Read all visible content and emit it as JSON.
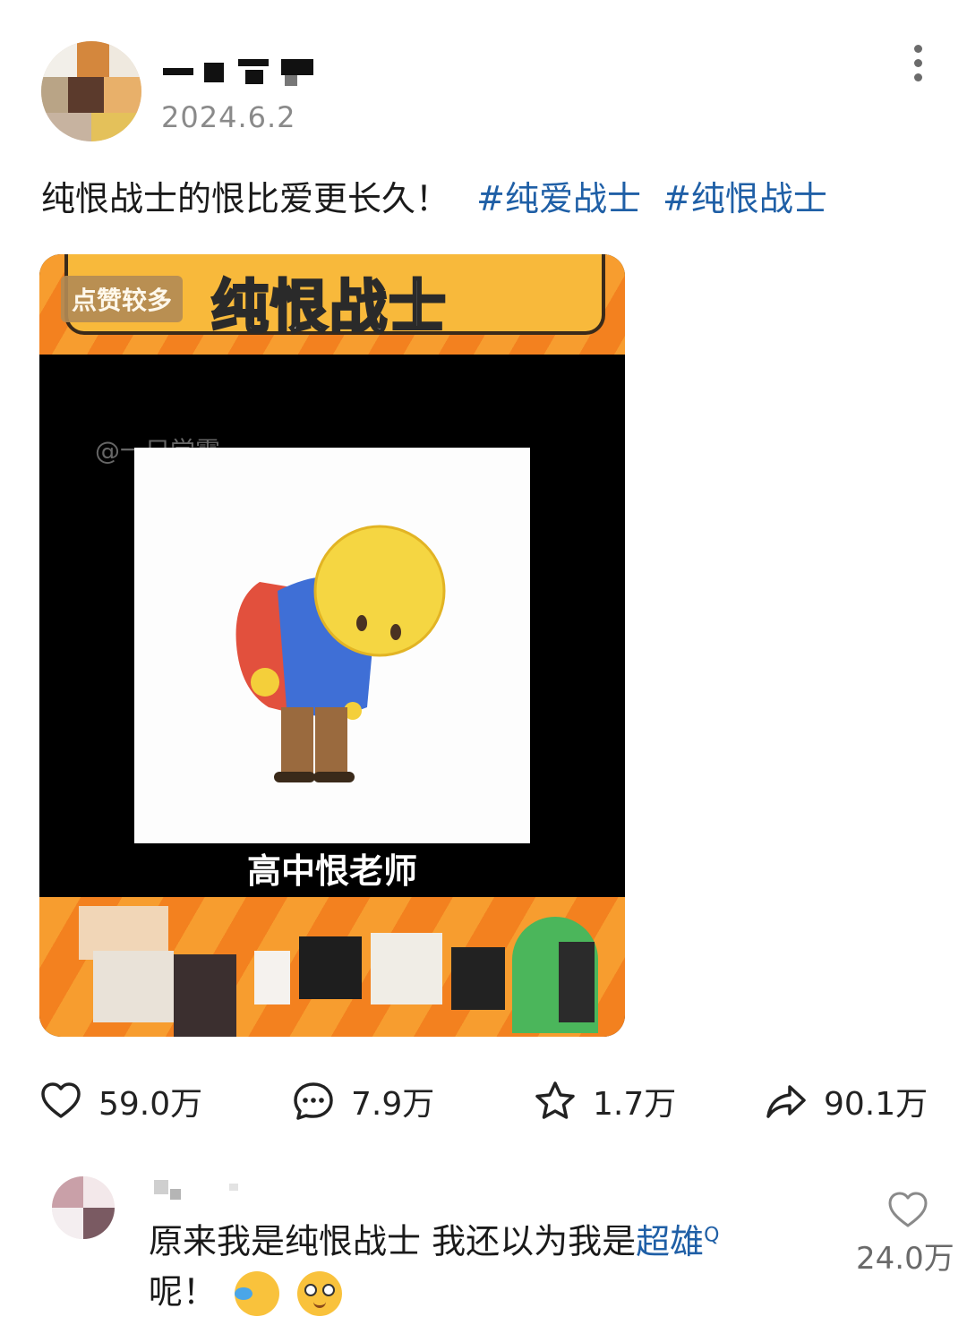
{
  "post": {
    "date": "2024.6.2",
    "text": "纯恨战士的恨比爱更长久！",
    "hashtags": [
      "#纯爱战士",
      "#纯恨战士"
    ]
  },
  "media": {
    "badge": "点赞较多",
    "title": "纯恨战士",
    "watermark": "@一只学霸",
    "caption": "高中恨老师"
  },
  "stats": {
    "likes": "59.0万",
    "comments": "7.9万",
    "favorites": "1.7万",
    "shares": "90.1万"
  },
  "comment": {
    "text_before": "原来我是纯恨战士 我还以为我是",
    "link": "超雄",
    "link_icon": "Q",
    "text_after": "呢！",
    "likes": "24.0万"
  },
  "icons": {
    "more": "more-vertical-icon",
    "like": "heart-icon",
    "comment": "comment-bubble-icon",
    "favorite": "star-icon",
    "share": "share-arrow-icon"
  },
  "colors": {
    "hashtag": "#1f5fa6",
    "banner_orange": "#f3811f",
    "banner_yellow": "#f8b93b"
  }
}
